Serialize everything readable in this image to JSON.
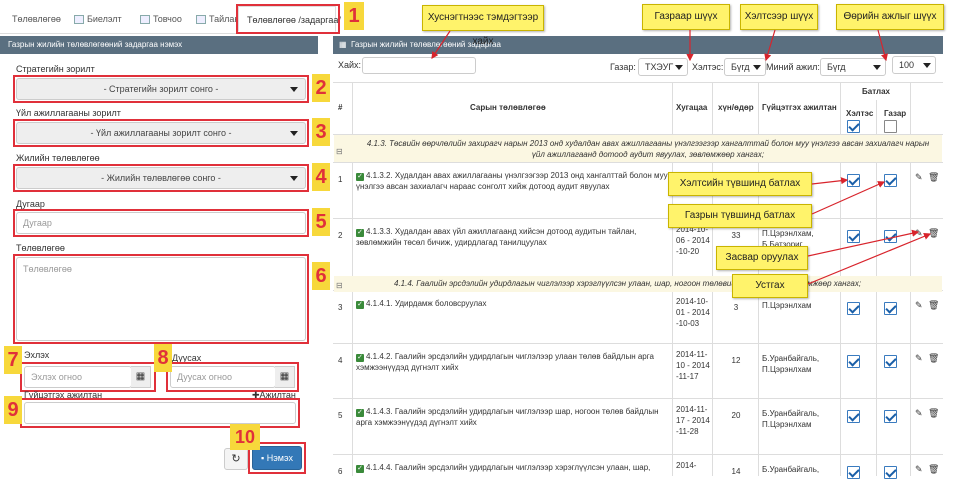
{
  "tabs": [
    {
      "label": "Төлөвлөгөө"
    },
    {
      "label": "Биелэлт"
    },
    {
      "label": "Товчоо"
    },
    {
      "label": "Тайлан"
    },
    {
      "label": "Төлөвлөгөө /задаргаа/"
    }
  ],
  "left_panel": {
    "header": "Газрын жилийн төлөвлөгөөний задаргаа нэмэх",
    "strategic_label": "Стратегийн зорилт",
    "strategic_value": "- Стратегийн зорилт сонго -",
    "activity_label": "Үйл ажиллагааны зорилт",
    "activity_value": "- Үйл ажиллагааны зорилт сонго -",
    "annual_label": "Жилийн төлөвлөгөө",
    "annual_value": "- Жилийн төлөвлөгөө сонго -",
    "number_label": "Дугаар",
    "number_placeholder": "Дугаар",
    "plan_label": "Төлөвлөгөө",
    "plan_placeholder": "Төлөвлөгөө",
    "start_label": "Эхлэх",
    "start_placeholder": "Эхлэх огноо",
    "end_label": "Дуусах",
    "end_placeholder": "Дуусах огноо",
    "staff_label": "Гүйцэтгэх ажилтан",
    "add_staff": "✚Ажилтан",
    "save_button": "Нэмэх"
  },
  "right_panel": {
    "header": "Газрын жилийн төлөвлөгөөний задаргаа",
    "search_label": "Хайх:",
    "dept_label": "Газар:",
    "dept_value": "ТХЭУГ",
    "mgmt_label": "Хэлтэс:",
    "mgmt_value": "Бүгд",
    "mywork_label": "Миний ажил:",
    "mywork_value": "Бүгд",
    "page_size": "100",
    "columns": {
      "num": "#",
      "plan": "Сарын төлөвлөгөө",
      "period": "Хугацаа",
      "days": "хүн/өдөр",
      "staff": "Гүйцэтгэх ажилтан",
      "approve": "Батлах",
      "approve_mgmt": "Хэлтэс",
      "approve_dept": "Газар"
    },
    "groups": [
      "4.1.3. Төсвийн өөрчлөлийн захирагч нарын 2013 онд худалдан авах ажиллагааны үнэлгээгээр хангалттай болон муу үнэлгээ авсан захиалагч нарын үйл ажиллагаанд дотоод аудит явуулах, зөвлөмжөөр хангах;",
      "4.1.4. Гаалийн эрсдэлийн удирдлагын чиглэлээр хэрэглүүлсэн улаан, шар, ногоон төлөвийн байдлын ... зөвлөмжөөр хангах;"
    ],
    "rows": [
      {
        "num": "1",
        "plan": "4.1.3.2. Худалдан авах ажиллагааны үнэлгээгээр 2013 онд хангалттай болон муу үнэлгээ авсан захиалагч нараас сонголт хийж дотоод аудит явуулах",
        "period": "",
        "days": "",
        "staff": "Г.Мөнхзул",
        "mgmt": true,
        "dept": true
      },
      {
        "num": "2",
        "plan": "4.1.3.3. Худалдан авах үйл ажиллагаанд хийсэн дотоод аудитын тайлан, зөвлөмжийн төсөл бичиж, удирдлагад танилцуулах",
        "period": "2014-10-06 - 2014-10-20",
        "days": "33",
        "staff": "П.Цэрэнлхам, Б.Батзориг",
        "mgmt": true,
        "dept": true
      },
      {
        "num": "3",
        "plan": "4.1.4.1. Удирдамж боловсруулах",
        "period": "2014-10-01 - 2014-10-03",
        "days": "3",
        "staff": "П.Цэрэнлхам",
        "mgmt": true,
        "dept": true
      },
      {
        "num": "4",
        "plan": "4.1.4.2. Гаалийн эрсдэлийн удирдлагын чиглэлээр улаан төлөв байдлын арга хэмжээнүүдэд дүгнэлт хийх",
        "period": "2014-11-10 - 2014-11-17",
        "days": "12",
        "staff": "Б.Уранбайгаль, П.Цэрэнлхам",
        "mgmt": true,
        "dept": true
      },
      {
        "num": "5",
        "plan": "4.1.4.3. Гаалийн эрсдэлийн удирдлагын чиглэлээр шар, ногоон төлөв байдлын арга хэмжээнүүдэд дүгнэлт хийх",
        "period": "2014-11-17 - 2014-11-28",
        "days": "20",
        "staff": "Б.Уранбайгаль, П.Цэрэнлхам",
        "mgmt": true,
        "dept": true
      },
      {
        "num": "6",
        "plan": "4.1.4.4. Гаалийн эрсдэлийн удирдлагын чиглэлээр хэрэглүүлсэн улаан, шар,",
        "period": "2014-",
        "days": "14",
        "staff": "Б.Уранбайгаль,",
        "mgmt": true,
        "dept": true
      }
    ]
  },
  "callouts": {
    "search": "Хуснэгтнээс тэмдэгтээр хайх",
    "dept": "Газраар шүүх",
    "mgmt": "Хэлтсээр шүүх",
    "mywork": "Өөрийн ажлыг шүүх",
    "approve_mgmt": "Хэлтсийн түвшинд батлах",
    "approve_dept": "Газрын түвшинд батлах",
    "edit": "Засвар оруулах",
    "delete": "Устгах"
  },
  "markers": [
    "1",
    "2",
    "3",
    "4",
    "5",
    "6",
    "7",
    "8",
    "9",
    "10"
  ],
  "colors": {
    "accent": "#3378b7",
    "header": "#5a6f80",
    "marker_bg": "#f7d83b",
    "marker_fg": "#e0303a",
    "callout": "#fff36b"
  }
}
